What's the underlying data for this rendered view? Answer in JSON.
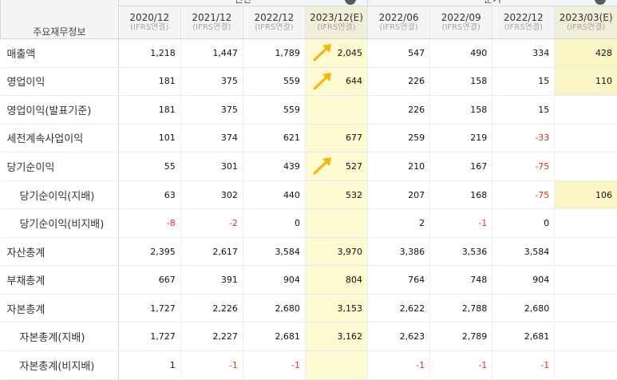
{
  "row_header": "주요재무정보",
  "groups": [
    {
      "label": "연간",
      "toggle": "−"
    },
    {
      "label": "분기",
      "toggle": "−"
    }
  ],
  "periods": [
    {
      "date": "2020/12",
      "basis": "(IFRS연결)"
    },
    {
      "date": "2021/12",
      "basis": "(IFRS연결)"
    },
    {
      "date": "2022/12",
      "basis": "(IFRS연결)"
    },
    {
      "date": "2023/12(E)",
      "basis": "(IFRS연결)"
    },
    {
      "date": "2022/06",
      "basis": "(IFRS연결)"
    },
    {
      "date": "2022/09",
      "basis": "(IFRS연결)"
    },
    {
      "date": "2022/12",
      "basis": "(IFRS연결)"
    },
    {
      "date": "2023/03(E)",
      "basis": "(IFRS연결)"
    }
  ],
  "rows": [
    {
      "label": "매출액",
      "values": [
        "1,218",
        "1,447",
        "1,789",
        "2,045",
        "547",
        "490",
        "334",
        "428"
      ]
    },
    {
      "label": "영업이익",
      "values": [
        "181",
        "375",
        "559",
        "644",
        "226",
        "158",
        "15",
        "110"
      ]
    },
    {
      "label": "영업이익(발표기준)",
      "values": [
        "181",
        "375",
        "559",
        "",
        "226",
        "158",
        "15",
        ""
      ]
    },
    {
      "label": "세전계속사업이익",
      "values": [
        "101",
        "374",
        "621",
        "677",
        "259",
        "219",
        "-33",
        ""
      ]
    },
    {
      "label": "당기순이익",
      "values": [
        "55",
        "301",
        "439",
        "527",
        "210",
        "167",
        "-75",
        ""
      ]
    },
    {
      "label": "당기순이익(지배)",
      "values": [
        "63",
        "302",
        "440",
        "532",
        "207",
        "168",
        "-75",
        "106"
      ]
    },
    {
      "label": "당기순이익(비지배)",
      "values": [
        "-8",
        "-2",
        "0",
        "",
        "2",
        "-1",
        "0",
        ""
      ]
    },
    {
      "label": "자산총계",
      "values": [
        "2,395",
        "2,617",
        "3,584",
        "3,970",
        "3,386",
        "3,536",
        "3,584",
        ""
      ]
    },
    {
      "label": "부채총계",
      "values": [
        "667",
        "391",
        "904",
        "804",
        "764",
        "748",
        "904",
        ""
      ]
    },
    {
      "label": "자본총계",
      "values": [
        "1,727",
        "2,226",
        "2,680",
        "3,153",
        "2,622",
        "2,788",
        "2,680",
        ""
      ]
    },
    {
      "label": "자본총계(지배)",
      "values": [
        "1,727",
        "2,227",
        "2,681",
        "3,162",
        "2,623",
        "2,789",
        "2,681",
        ""
      ]
    },
    {
      "label": "자본총계(비지배)",
      "values": [
        "1",
        "-1",
        "-1",
        "",
        "-1",
        "-1",
        "-1",
        ""
      ]
    }
  ],
  "colors": {
    "estimate_bg": "#fdf9d0",
    "negative": "#e0301e",
    "arrow": "#f2b705"
  }
}
